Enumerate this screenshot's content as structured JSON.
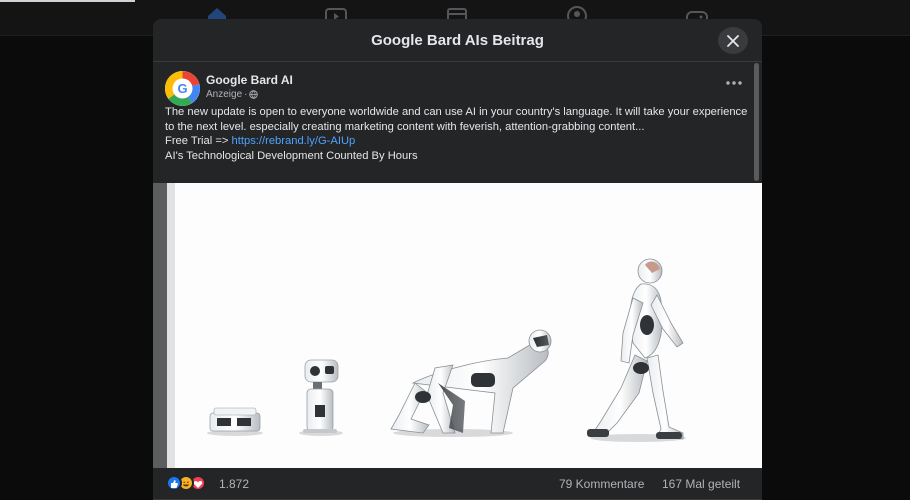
{
  "modal": {
    "title": "Google Bard AIs Beitrag"
  },
  "post": {
    "author": "Google Bard AI",
    "sponsored_label": "Anzeige",
    "meta_separator": "·",
    "text_line1": "The new update is open to everyone worldwide and can use AI in your country's language. It will take your experience to the next level. especially creating marketing content with feverish, attention-grabbing content...",
    "trial_prefix": "Free Trial => ",
    "trial_link": "https://rebrand.ly/G-AIUp",
    "text_line3": "AI's Technological Development Counted By Hours",
    "avatar_letter": "G"
  },
  "stats": {
    "reaction_count": "1.872",
    "comments": "79 Kommentare",
    "shares": "167 Mal geteilt"
  },
  "icons": {
    "nav": [
      "home-icon",
      "video-icon",
      "marketplace-icon",
      "groups-icon",
      "gaming-icon"
    ],
    "reactions": [
      "like-icon",
      "haha-icon",
      "love-icon"
    ]
  },
  "colors": {
    "link": "#4ea3ff",
    "like": "#1877f2",
    "love": "#f33e58",
    "haha": "#f7b125"
  }
}
